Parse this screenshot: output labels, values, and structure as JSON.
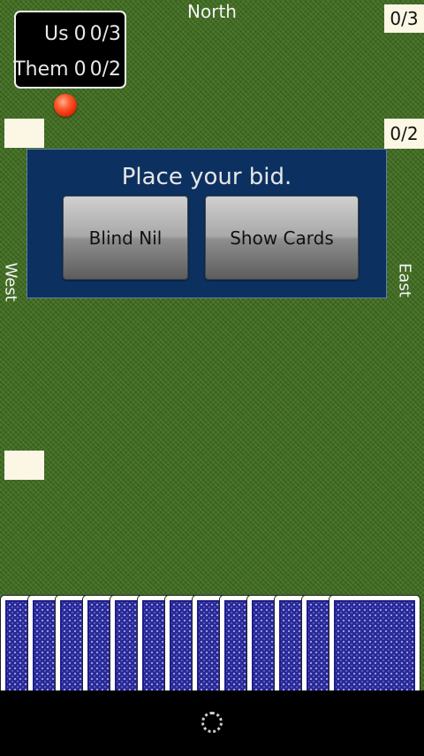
{
  "seats": {
    "north": "North",
    "west": "West",
    "east": "East"
  },
  "score": {
    "us": {
      "label": "Us",
      "points": "0",
      "bags": "0/3"
    },
    "them": {
      "label": "Them",
      "points": "0",
      "bags": "0/2"
    }
  },
  "bids": {
    "north": "0/3",
    "east": "0/2",
    "west": "",
    "south": ""
  },
  "dialog": {
    "prompt": "Place your bid.",
    "blind_nil_label": "Blind Nil",
    "show_cards_label": "Show Cards"
  },
  "hand": {
    "card_count": 13,
    "face": "down"
  },
  "colors": {
    "felt": "#3f6c1f",
    "dialog": "#0c3160",
    "card_back": "#2a2a96",
    "dealer_marker": "#ff5a2a"
  }
}
